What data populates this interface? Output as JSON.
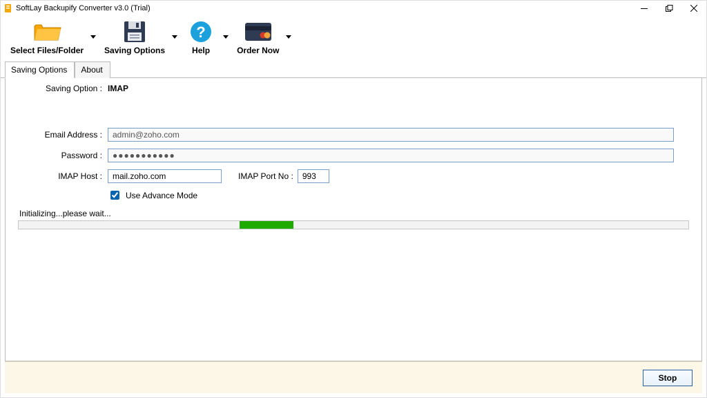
{
  "window": {
    "title": "SoftLay Backupify Converter v3.0 (Trial)"
  },
  "toolbar": {
    "select_files": "Select Files/Folder",
    "saving_options": "Saving Options",
    "help": "Help",
    "order_now": "Order Now"
  },
  "tabs": {
    "saving_options": "Saving Options",
    "about": "About"
  },
  "form": {
    "saving_option_label": "Saving Option  :",
    "saving_option_value": "IMAP",
    "email_label": "Email Address  :",
    "email_value": "admin@zoho.com",
    "password_label": "Password  :",
    "password_value": "●●●●●●●●●●●",
    "host_label": "IMAP Host  :",
    "host_value": "mail.zoho.com",
    "port_label": "IMAP Port No  :",
    "port_value": "993",
    "advance_label": "Use Advance Mode",
    "advance_checked": true
  },
  "status": {
    "text": "Initializing...please wait...",
    "progress_left_pct": 33,
    "progress_width_pct": 8
  },
  "footer": {
    "stop": "Stop"
  }
}
